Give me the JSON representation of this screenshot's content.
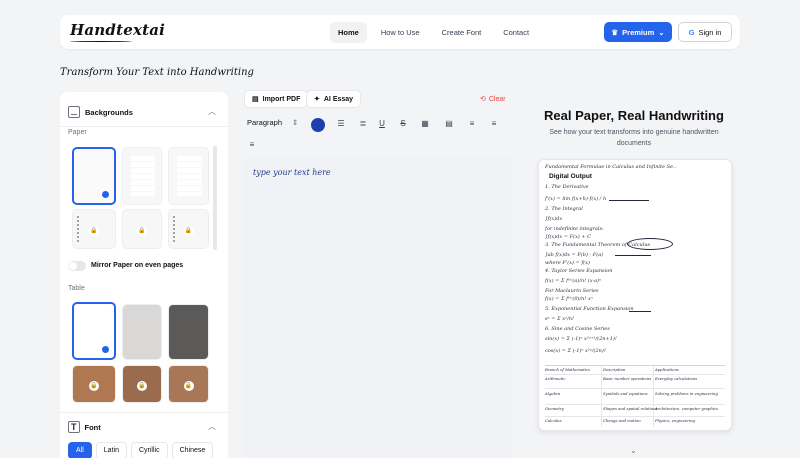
{
  "header": {
    "logo": "Handtextai",
    "nav": [
      "Home",
      "How to Use",
      "Create Font",
      "Contact"
    ],
    "premium_label": "Premium",
    "signin_label": "Sign in"
  },
  "tagline": "Transform Your Text into Handwriting",
  "sidebar": {
    "backgrounds_title": "Backgrounds",
    "paper_label": "Paper",
    "mirror_label": "Mirror Paper on even pages",
    "table_label": "Table",
    "font_title": "Font",
    "font_tabs": [
      "All",
      "Latin",
      "Cyrillic",
      "Chinese"
    ]
  },
  "editor": {
    "import_label": "Import PDF",
    "ai_label": "AI Essay",
    "clear_label": "Clear",
    "paragraph_label": "Paragraph",
    "placeholder": "type your text here",
    "text_color": "#1e40af"
  },
  "preview": {
    "title": "Real Paper, Real Handwriting",
    "subtitle": "See how your text transforms into genuine handwritten documents",
    "output_label": "Digital Output",
    "lines": [
      "Fundamental Formulae in Calculus and Infinite Se..",
      "1. The Derivative",
      "f'(x) = lim f(x+h)-f(x) / h",
      "2. The Integral",
      "∫f(x)dx",
      "for indefinite integrals:",
      "∫f(x)dx = F(x) + C",
      "3. The Fundamental Theorem of Calculus",
      "∫ab f(x)dx = F(b) - F(a)",
      "where F'(x) = f(x)",
      "4. Taylor Series Expansion",
      "f(x) = Σ f⁽ⁿ⁾(a)/n! (x-a)ⁿ",
      "For Maclaurin Series",
      "f(x) = Σ f⁽ⁿ⁾(0)/n! xⁿ",
      "5. Exponential Function Expansion",
      "eˣ = Σ xⁿ/n!",
      "6. Sine and Cosine Series",
      "sin(x) = Σ (-1)ⁿ x²ⁿ⁺¹/(2n+1)!",
      "cos(x) = Σ (-1)ⁿ x²ⁿ/(2n)!"
    ],
    "table_rows": [
      [
        "Branch of Mathematics",
        "Description",
        "Applications"
      ],
      [
        "Arithmetic",
        "Basic number operations",
        "Everyday calculations"
      ],
      [
        "Algebra",
        "Symbols and equations",
        "Solving problems in engineering"
      ],
      [
        "Geometry",
        "Shapes and spatial relations",
        "Architecture, computer graphics"
      ],
      [
        "Calculus",
        "Change and motion",
        "Physics, engineering"
      ]
    ]
  }
}
